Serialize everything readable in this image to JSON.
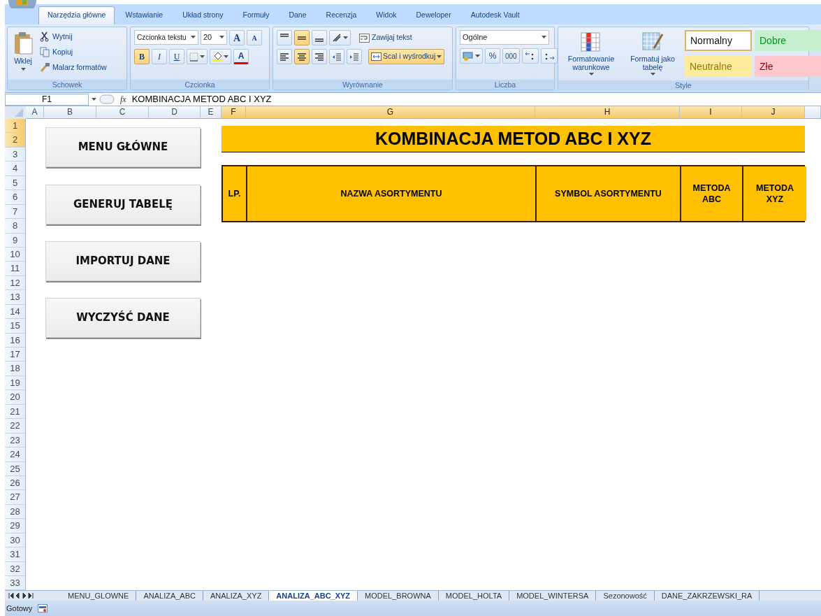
{
  "ribbon_tabs": [
    {
      "label": "Narzędzia główne",
      "selected": true
    },
    {
      "label": "Wstawianie",
      "selected": false
    },
    {
      "label": "Układ strony",
      "selected": false
    },
    {
      "label": "Formuły",
      "selected": false
    },
    {
      "label": "Dane",
      "selected": false
    },
    {
      "label": "Recenzja",
      "selected": false
    },
    {
      "label": "Widok",
      "selected": false
    },
    {
      "label": "Deweloper",
      "selected": false
    },
    {
      "label": "Autodesk Vault",
      "selected": false
    }
  ],
  "clipboard": {
    "paste": "Wklej",
    "items": [
      "Wytnij",
      "Kopiuj",
      "Malarz formatów"
    ],
    "group_label": "Schowek"
  },
  "font": {
    "font_name": "Czcionka tekstu",
    "font_size": "20",
    "grow": "A",
    "shrink": "A",
    "bold": {
      "label": "B",
      "on": true
    },
    "italic": {
      "label": "I",
      "on": false
    },
    "underline": {
      "label": "U",
      "on": false
    },
    "font_color": "A",
    "group_label": "Czcionka"
  },
  "alignment": {
    "vertical": [
      {
        "selected": false
      },
      {
        "selected": true
      },
      {
        "selected": false
      }
    ],
    "horizontal": [
      {
        "selected": false
      },
      {
        "selected": true
      },
      {
        "selected": false
      }
    ],
    "wrap": "Zawijaj tekst",
    "merge": {
      "label": "Scal i wyśrodkuj",
      "on": true
    },
    "group_label": "Wyrównanie"
  },
  "number": {
    "format": "Ogólne",
    "percent": "%",
    "thousands": "000",
    "group_label": "Liczba"
  },
  "styles": {
    "conditional": "Formatowanie warunkowe",
    "as_table": "Formatuj jako tabelę",
    "cells": [
      {
        "label": "Normalny",
        "color": "#ffffff",
        "selected": true
      },
      {
        "label": "Dobre",
        "color": "#c6efce",
        "selected": false
      },
      {
        "label": "Neutralne",
        "color": "#ffeb9c",
        "selected": false
      },
      {
        "label": "Złe",
        "color": "#ffc7ce",
        "selected": false
      }
    ],
    "group_label": "Style"
  },
  "formula_bar": {
    "name_box": "F1",
    "fx": "fx",
    "content": "KOMBINACJA METOD ABC I XYZ"
  },
  "columns": [
    {
      "label": "A",
      "selected": false
    },
    {
      "label": "B",
      "selected": false
    },
    {
      "label": "C",
      "selected": false
    },
    {
      "label": "D",
      "selected": false
    },
    {
      "label": "E",
      "selected": false
    },
    {
      "label": "F",
      "selected": true
    },
    {
      "label": "G",
      "selected": true
    },
    {
      "label": "H",
      "selected": true
    },
    {
      "label": "I",
      "selected": true
    },
    {
      "label": "J",
      "selected": true
    }
  ],
  "rows": [
    {
      "label": "1",
      "selected": true
    },
    {
      "label": "2",
      "selected": true
    },
    {
      "label": "3",
      "selected": false
    },
    {
      "label": "4",
      "selected": false
    },
    {
      "label": "5",
      "selected": false
    },
    {
      "label": "6",
      "selected": false
    },
    {
      "label": "7",
      "selected": false
    },
    {
      "label": "8",
      "selected": false
    },
    {
      "label": "9",
      "selected": false
    },
    {
      "label": "10",
      "selected": false
    },
    {
      "label": "11",
      "selected": false
    },
    {
      "label": "12",
      "selected": false
    },
    {
      "label": "13",
      "selected": false
    },
    {
      "label": "14",
      "selected": false
    },
    {
      "label": "15",
      "selected": false
    },
    {
      "label": "16",
      "selected": false
    },
    {
      "label": "17",
      "selected": false
    },
    {
      "label": "18",
      "selected": false
    },
    {
      "label": "19",
      "selected": false
    },
    {
      "label": "20",
      "selected": false
    },
    {
      "label": "21",
      "selected": false
    },
    {
      "label": "22",
      "selected": false
    },
    {
      "label": "23",
      "selected": false
    },
    {
      "label": "24",
      "selected": false
    },
    {
      "label": "25",
      "selected": false
    },
    {
      "label": "26",
      "selected": false
    },
    {
      "label": "27",
      "selected": false
    },
    {
      "label": "28",
      "selected": false
    },
    {
      "label": "29",
      "selected": false
    },
    {
      "label": "30",
      "selected": false
    },
    {
      "label": "31",
      "selected": false
    },
    {
      "label": "32",
      "selected": false
    },
    {
      "label": "33",
      "selected": false
    }
  ],
  "sheet": {
    "title": "KOMBINACJA METOD ABC I XYZ",
    "table_headers": [
      "LP.",
      "NAZWA ASORTYMENTU",
      "SYMBOL ASORTYMENTU",
      "METODA ABC",
      "METODA XYZ"
    ],
    "buttons": [
      "MENU GŁÓWNE",
      "GENERUJ TABELĘ",
      "IMPORTUJ DANE",
      "WYCZYŚĆ DANE"
    ]
  },
  "sheet_tabs": [
    {
      "label": "MENU_GLOWNE",
      "selected": false
    },
    {
      "label": "ANALIZA_ABC",
      "selected": false
    },
    {
      "label": "ANALIZA_XYZ",
      "selected": false
    },
    {
      "label": "ANALIZA_ABC_XYZ",
      "selected": true
    },
    {
      "label": "MODEL_BROWNA",
      "selected": false
    },
    {
      "label": "MODEL_HOLTA",
      "selected": false
    },
    {
      "label": "MODEL_WINTERSA",
      "selected": false
    },
    {
      "label": "Sezonowość",
      "selected": false
    },
    {
      "label": "DANE_ZAKRZEWSKI_RA",
      "selected": false
    }
  ],
  "status_bar": {
    "text": "Gotowy"
  }
}
